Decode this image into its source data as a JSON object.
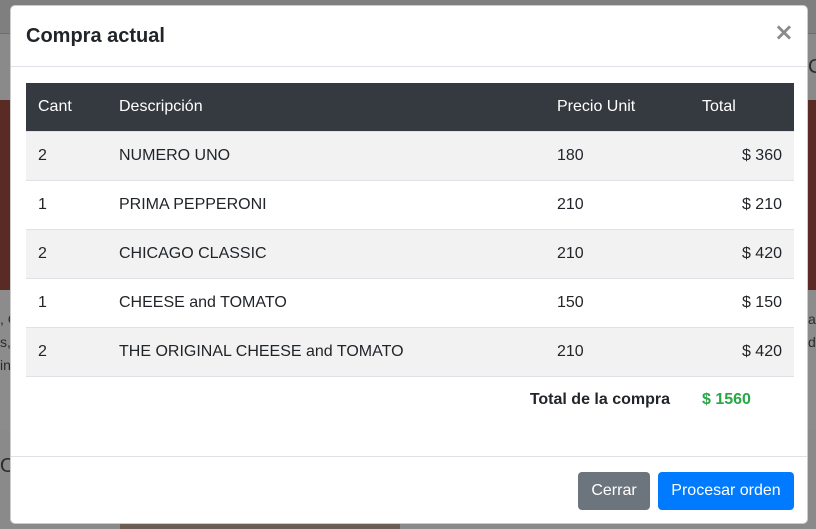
{
  "modal": {
    "title": "Compra actual",
    "close_symbol": "×"
  },
  "table": {
    "headers": [
      "Cant",
      "Descripción",
      "Precio Unit",
      "Total"
    ],
    "rows": [
      {
        "qty": "2",
        "desc": "NUMERO UNO",
        "price": "180",
        "total": "$ 360"
      },
      {
        "qty": "1",
        "desc": "PRIMA PEPPERONI",
        "price": "210",
        "total": "$ 210"
      },
      {
        "qty": "2",
        "desc": "CHICAGO CLASSIC",
        "price": "210",
        "total": "$ 420"
      },
      {
        "qty": "1",
        "desc": "CHEESE and TOMATO",
        "price": "150",
        "total": "$ 150"
      },
      {
        "qty": "2",
        "desc": "THE ORIGINAL CHEESE and TOMATO",
        "price": "210",
        "total": "$ 420"
      }
    ],
    "total_label": "Total de la compra",
    "total_value": "$ 1560"
  },
  "footer": {
    "close_label": "Cerrar",
    "process_label": "Procesar orden"
  },
  "background": {
    "left_fragments": [
      ", C",
      "s,",
      "in"
    ],
    "right_fragments": [
      "C",
      "a",
      "d"
    ],
    "left_bottom_fragment": "O"
  },
  "colors": {
    "header_dark": "#343a40",
    "total_green": "#28a745",
    "primary": "#007bff",
    "secondary": "#6c757d"
  }
}
